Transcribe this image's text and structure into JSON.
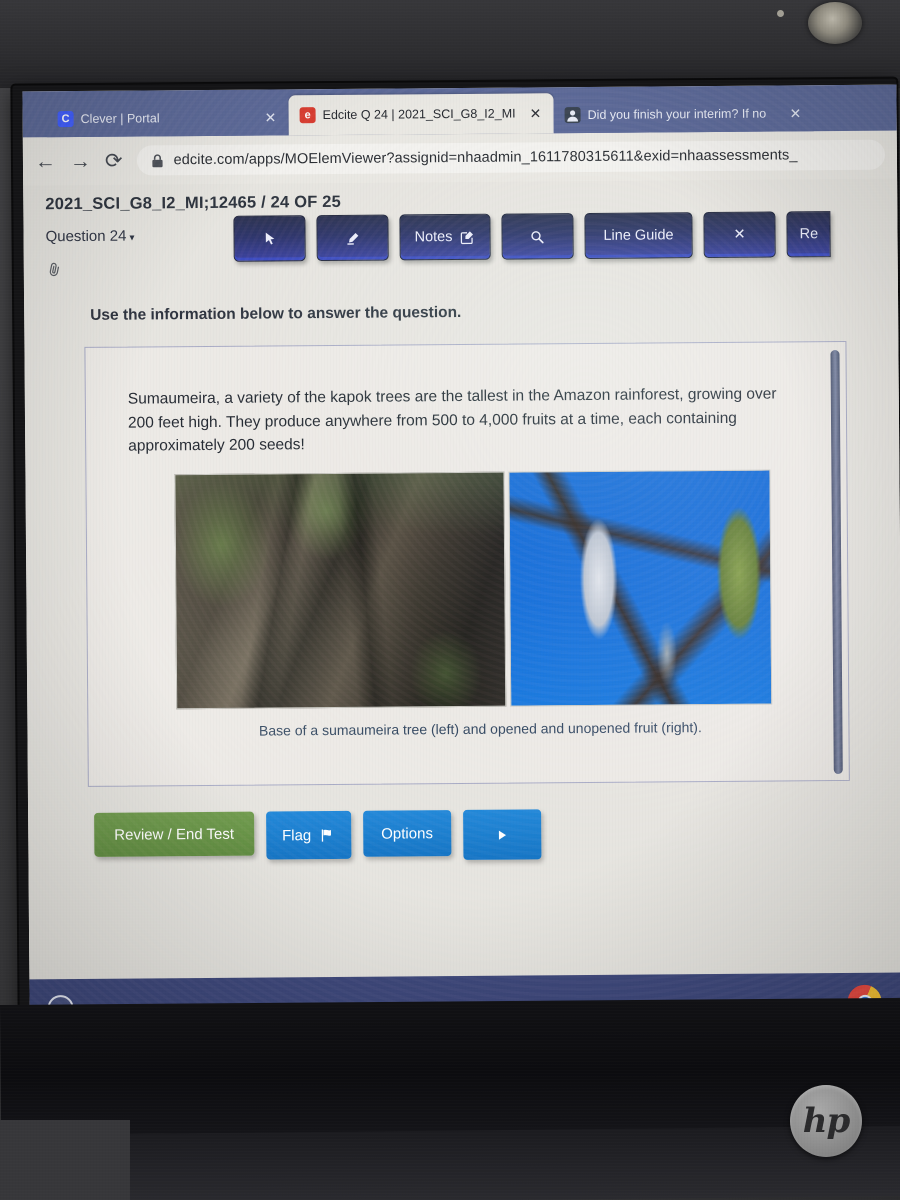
{
  "device": {
    "brand_logo": "hp",
    "webcam_icon": "webcam-icon"
  },
  "browser": {
    "tabs": [
      {
        "title": "Clever | Portal",
        "favicon": "clever-favicon",
        "favicon_letter": "C",
        "active": false,
        "close_label": "✕"
      },
      {
        "title": "Edcite Q 24 | 2021_SCI_G8_I2_MI",
        "favicon": "edcite-favicon",
        "favicon_letter": "e",
        "active": true,
        "close_label": "✕"
      },
      {
        "title": "Did you finish your interim? If no",
        "favicon": "person-favicon",
        "favicon_letter": "■",
        "active": false,
        "close_label": "✕"
      }
    ],
    "nav": {
      "back_icon": "←",
      "forward_icon": "→",
      "reload_icon": "⟳"
    },
    "address_bar": {
      "lock_icon": "🔒",
      "url": "edcite.com/apps/MOElemViewer?assignid=nhaadmin_1611780315611&exid=nhaassessments_"
    }
  },
  "app": {
    "assessment_id": "2021_SCI_G8_I2_MI;12465 / 24 OF 25",
    "question_selector": {
      "label": "Question 24",
      "caret": "▾"
    },
    "attachment_icon": "paperclip-icon",
    "toolbar": [
      {
        "name": "pointer-tool",
        "label": "",
        "icon": "cursor-arrow-icon"
      },
      {
        "name": "highlighter-tool",
        "label": "",
        "icon": "highlighter-icon"
      },
      {
        "name": "notes-button",
        "label": "Notes",
        "icon": "edit-square-icon"
      },
      {
        "name": "magnifier-tool",
        "label": "",
        "icon": "magnifier-icon"
      },
      {
        "name": "line-guide-button",
        "label": "Line Guide",
        "icon": ""
      },
      {
        "name": "close-tool-button",
        "label": "✕",
        "icon": ""
      },
      {
        "name": "reset-button",
        "label": "Re",
        "icon": ""
      }
    ],
    "instruction": "Use the information below to answer the question.",
    "stimulus": {
      "passage": "Sumaumeira, a variety of the kapok trees are the tallest in the Amazon rainforest, growing over 200 feet high. They produce anywhere from 500 to 4,000 fruits at a time, each containing approximately 200 seeds!",
      "figure_caption": "Base of a sumaumeira tree (left) and opened and unopened fruit (right).",
      "image_left_alt": "Photograph of the buttress roots at the base of a large sumaumeira tree in the rainforest",
      "image_right_alt": "Photograph of opened white fibrous fruit and unopened green pod fruits hanging from branches against a blue sky"
    },
    "footer_buttons": [
      {
        "name": "review-end-test-button",
        "label": "Review / End Test",
        "color": "#5f8a3e"
      },
      {
        "name": "flag-button",
        "label": "Flag",
        "icon": "flag-icon",
        "color": "#1272c4"
      },
      {
        "name": "options-button",
        "label": "Options",
        "color": "#1272c4"
      },
      {
        "name": "next-question-button",
        "label": "",
        "icon": "play-triangle-icon",
        "color": "#1272c4"
      }
    ]
  },
  "shelf": {
    "launcher_icon": "launcher-circle-icon",
    "chrome_icon": "chrome-icon"
  }
}
